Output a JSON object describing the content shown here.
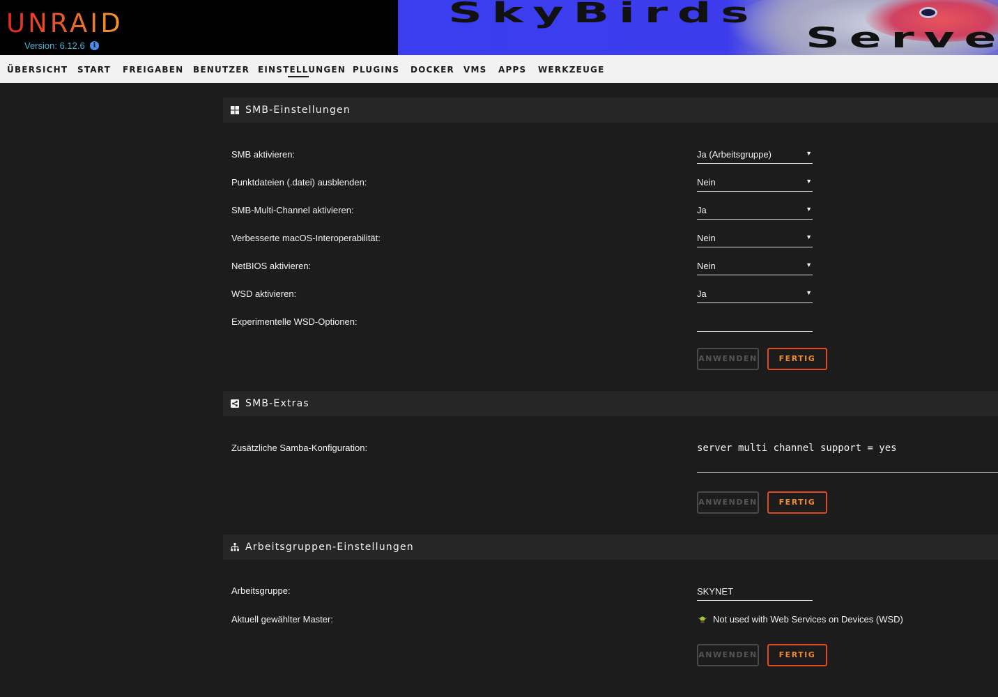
{
  "header": {
    "logo": "UNRAID",
    "version": "Version: 6.12.6",
    "banner_text_1": "SkyBirds",
    "banner_text_2": "Serve"
  },
  "nav": {
    "items": [
      "ÜBERSICHT",
      "START",
      "FREIGABEN",
      "BENUTZER",
      "EINSTELLUNGEN",
      "PLUGINS",
      "DOCKER",
      "VMS",
      "APPS",
      "WERKZEUGE"
    ],
    "active": "EINSTELLUNGEN"
  },
  "smb_settings": {
    "title": "SMB-Einstellungen",
    "rows": [
      {
        "label": "SMB aktivieren:",
        "value": "Ja (Arbeitsgruppe)"
      },
      {
        "label": "Punktdateien (.datei) ausblenden:",
        "value": "Nein"
      },
      {
        "label": "SMB-Multi-Channel aktivieren:",
        "value": "Ja"
      },
      {
        "label": "Verbesserte macOS-Interoperabilität:",
        "value": "Nein"
      },
      {
        "label": "NetBIOS aktivieren:",
        "value": "Nein"
      },
      {
        "label": "WSD aktivieren:",
        "value": "Ja"
      },
      {
        "label": "Experimentelle WSD-Optionen:",
        "value": ""
      }
    ],
    "apply_label": "ANWENDEN",
    "done_label": "FERTIG"
  },
  "smb_extras": {
    "title": "SMB-Extras",
    "label": "Zusätzliche Samba-Konfiguration:",
    "value": "server multi channel support = yes",
    "apply_label": "ANWENDEN",
    "done_label": "FERTIG"
  },
  "workgroup": {
    "title": "Arbeitsgruppen-Einstellungen",
    "workgroup_label": "Arbeitsgruppe:",
    "workgroup_value": "SKYNET",
    "master_label": "Aktuell gewählter Master:",
    "master_value": "Not used with Web Services on Devices (WSD)",
    "apply_label": "ANWENDEN",
    "done_label": "FERTIG"
  },
  "colors": {
    "background": "#1c1c1c",
    "section_header": "#262626",
    "accent": "#e24a24",
    "version": "#4ab4d4"
  }
}
